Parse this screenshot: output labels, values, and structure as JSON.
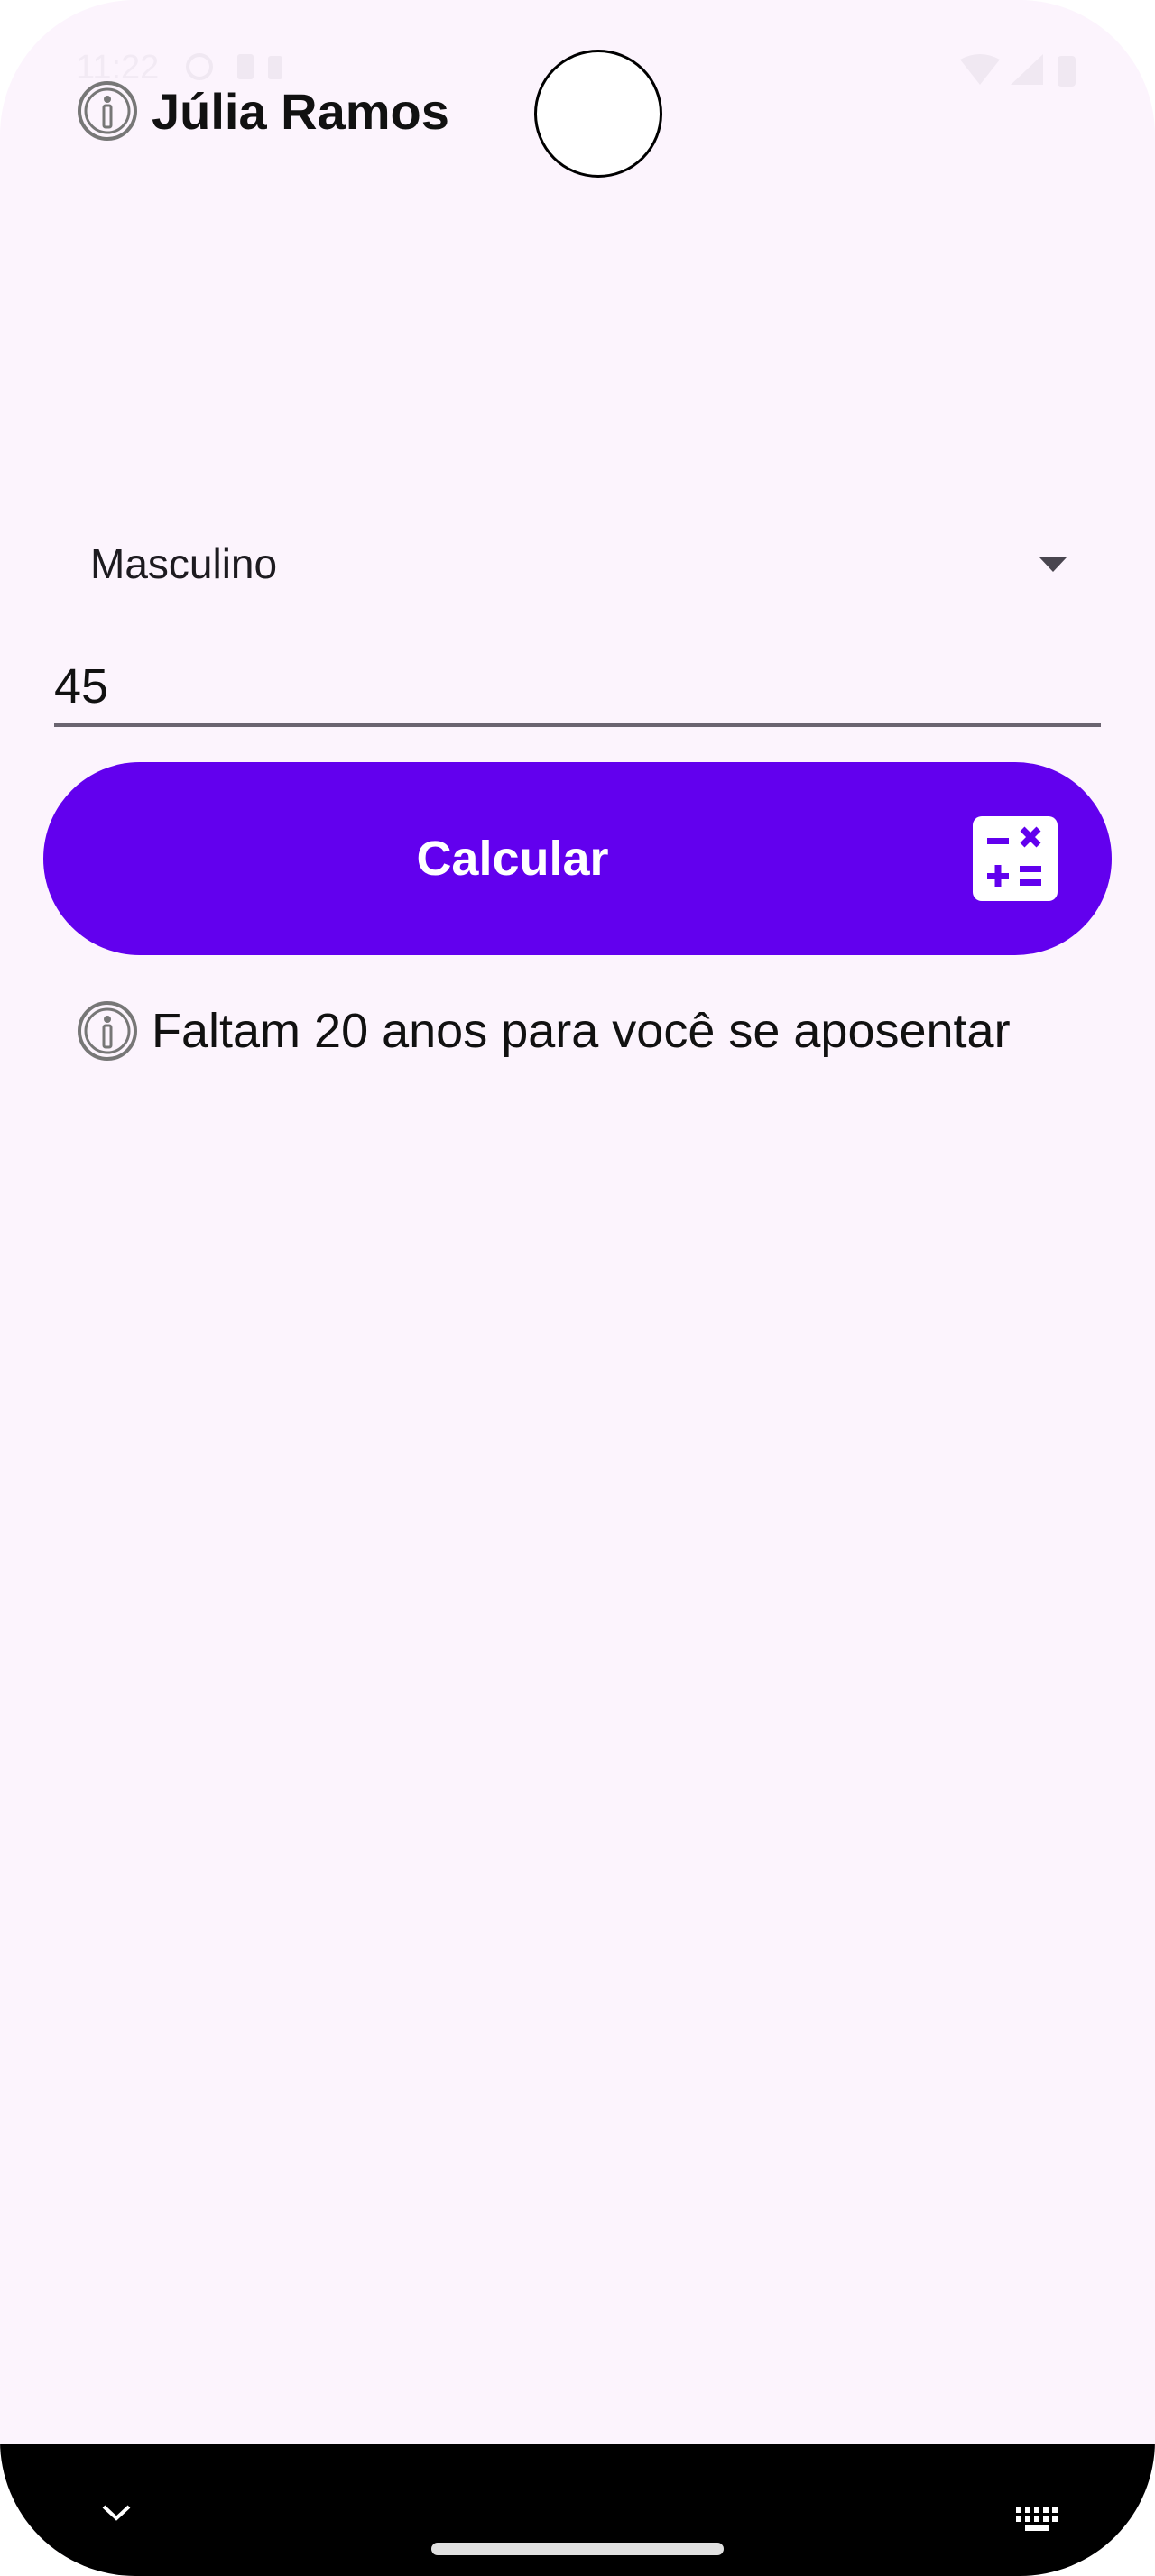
{
  "status_bar": {
    "time": "11:22"
  },
  "header": {
    "title": "Júlia Ramos",
    "icon": "info-icon"
  },
  "form": {
    "gender_select": {
      "selected": "Masculino"
    },
    "age_input": {
      "value": "45"
    },
    "calculate_button": {
      "label": "Calcular",
      "icon": "calculator-icon"
    }
  },
  "result": {
    "icon": "info-icon",
    "text": "Faltam 20 anos para você se aposentar"
  },
  "colors": {
    "background": "#fcf4fd",
    "accent": "#6200ee",
    "nav_bar": "#000000"
  }
}
